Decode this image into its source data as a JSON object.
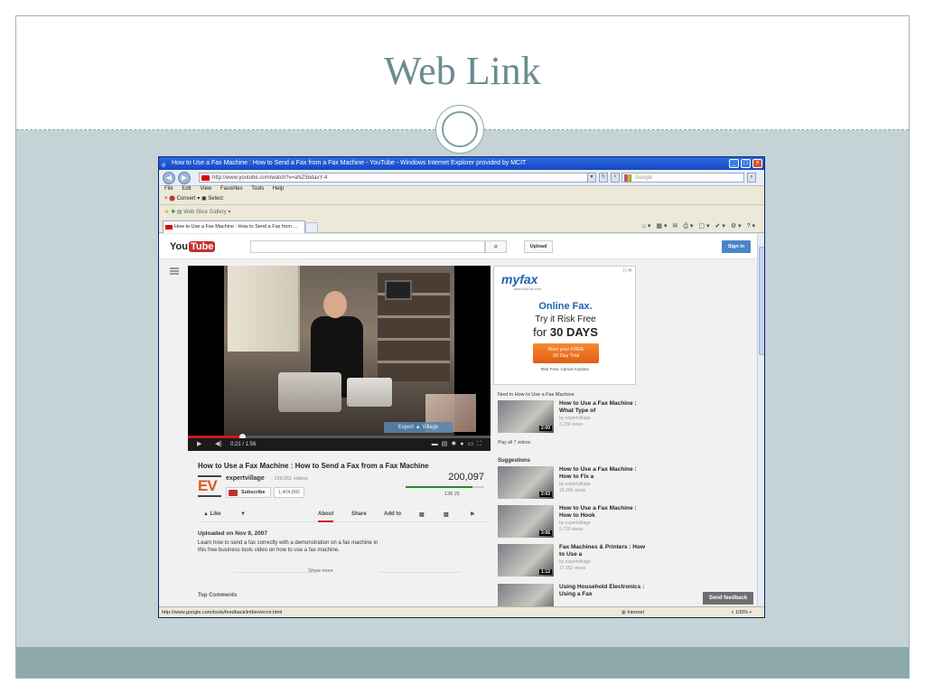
{
  "slide": {
    "title": "Web Link"
  },
  "browser": {
    "window_title": "How to Use a Fax Machine : How to Send a Fax from a Fax Machine - YouTube - Windows Internet Explorer provided by MCIT",
    "address": "http://www.youtube.com/watch?v=aNZ5bdavY-4",
    "search_placeholder": "Google",
    "menu": [
      "File",
      "Edit",
      "View",
      "Favorites",
      "Tools",
      "Help"
    ],
    "toolbar": {
      "convert_label": "Convert",
      "select_label": "Select"
    },
    "favorites": {
      "web_slice_label": "Web Slice Gallery"
    },
    "tab_title": "How to Use a Fax Machine : How to Send a Fax from ...",
    "status_url": "http://www.google.com/tools/feedback/intl/en/error.html",
    "status_zone": "Internet",
    "status_zoom": "100%"
  },
  "youtube": {
    "logo_you": "You",
    "logo_tube": "Tube",
    "upload_label": "Upload",
    "signin_label": "Sign in",
    "player": {
      "time": "0:21 / 1:56",
      "overlay_label": "Expert ▲ Village",
      "progress": 0.18
    },
    "video": {
      "title": "How to Use a Fax Machine : How to Send a Fax from a Fax Machine",
      "channel_name": "expertvillage",
      "channel_videos": "· 139,051 videos",
      "subscribe_label": "Subscribe",
      "subscriber_count": "1,404,882",
      "views": "200,097",
      "like_ratio": 0.85,
      "likes_text": "138   25",
      "actions": {
        "like": "Like",
        "about": "About",
        "share": "Share",
        "add_to": "Add to"
      },
      "upload_date": "Uploaded on Nov 9, 2007",
      "description": "Learn how to send a fax correctly with a demonstration on a fax machine in this free business tools video on how to use a fax machine.",
      "show_more": "Show more",
      "top_comments": "Top Comments"
    },
    "ad": {
      "logo": "myfax",
      "logo_sub": "www.MyFax.com",
      "headline": "Online Fax.",
      "line2": "Try it Risk Free",
      "line3_prefix": "for ",
      "line3_bold": "30 DAYS",
      "cta_line1": "Start your FREE",
      "cta_line2": "30 Day Trial",
      "fine_print": "Risk Free. Cancel Anytime."
    },
    "sidebar": {
      "next_label": "Next in How to Use a Fax Machine",
      "play_all": "Play all 7 videos",
      "suggestions_label": "Suggestions",
      "next_item": {
        "title": "How to Use a Fax Machine : What Type of",
        "by": "by expertvillage",
        "views": "3,230 views",
        "duration": "2:00"
      },
      "items": [
        {
          "title": "How to Use a Fax Machine : How to Fix a",
          "by": "by expertvillage",
          "views": "15,399 views",
          "duration": "2:03"
        },
        {
          "title": "How to Use a Fax Machine : How to Hook",
          "by": "by expertvillage",
          "views": "9,729 views",
          "duration": "3:06"
        },
        {
          "title": "Fax Machines & Printers : How to Use a",
          "by": "by expertvillage",
          "views": "17,652 views",
          "duration": "1:12"
        },
        {
          "title": "Using Household Electronics : Using a Fax",
          "by": "",
          "views": "",
          "duration": ""
        }
      ]
    },
    "feedback_label": "Send feedback"
  }
}
